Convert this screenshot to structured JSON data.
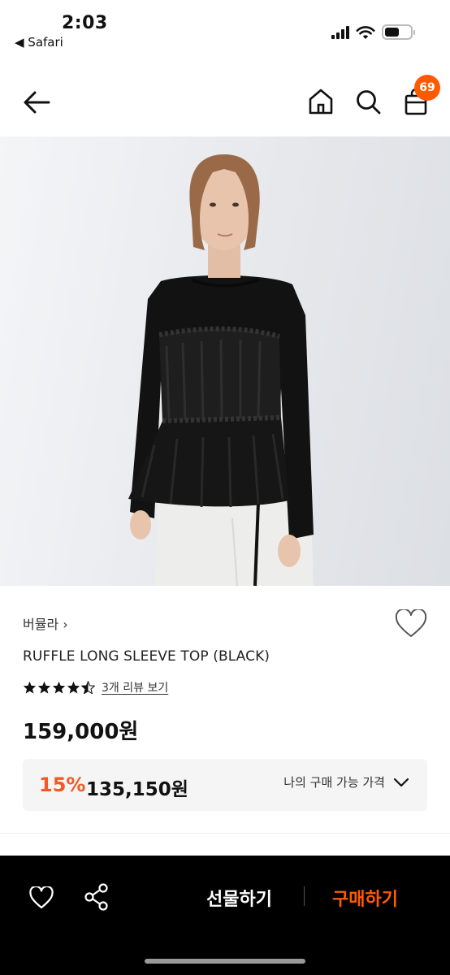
{
  "status_bar": {
    "time": "2:03",
    "back_label": "◀ Safari"
  },
  "header": {
    "cart_count": "69",
    "icons": [
      "back-arrow-icon",
      "home-icon",
      "search-icon",
      "shopping-bag-icon"
    ]
  },
  "product": {
    "brand": "버뮬라 ›",
    "name": "RUFFLE LONG SLEEVE TOP (BLACK)",
    "rating": 4.5,
    "review_link": "3개 리뷰 보기",
    "price": "159,000원",
    "discount": {
      "rate": "15%",
      "price": "135,150원",
      "my_price_label": "나의 구매 가능 가격"
    }
  },
  "bottom_bar": {
    "gift_label": "선물하기",
    "buy_label": "구매하기"
  },
  "colors": {
    "accent": "#ff5a00",
    "discount": "#f15a24",
    "bottom_bar_bg": "#000000"
  }
}
